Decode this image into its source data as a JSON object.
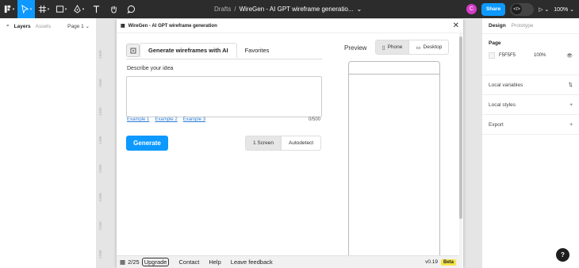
{
  "toolbar": {
    "breadcrumb_root": "Drafts",
    "breadcrumb_sep": "/",
    "file_name": "WireGen - AI GPT wireframe generatio...",
    "avatar_initial": "C",
    "share_label": "Share",
    "zoom": "100%"
  },
  "left_panel": {
    "tab_layers": "Layers",
    "tab_assets": "Assets",
    "page_selector": "Page 1"
  },
  "ruler_ticks": [
    "-1550",
    "-1500",
    "-1450",
    "-1400",
    "-1350",
    "-1300",
    "-1250",
    "-1200"
  ],
  "plugin": {
    "title": "WireGen - AI GPT wireframe generation",
    "tabs": [
      {
        "label": "Generate wireframes with AI"
      },
      {
        "label": "Favorites"
      }
    ],
    "idea_label": "Describe your idea",
    "idea_value": "",
    "examples": [
      "Example 1",
      "Example 2",
      "Example 3"
    ],
    "char_count": "0/500",
    "generate_label": "Generate",
    "mode_options": [
      "1 Screen",
      "Autodetect"
    ],
    "mode_selected": "1 Screen",
    "preview_label": "Preview",
    "device_options": [
      "Phone",
      "Desktop"
    ],
    "device_selected": "Phone",
    "footer": {
      "usage": "2/25",
      "upgrade": "Upgrade",
      "links": [
        "Contact",
        "Help",
        "Leave feedback"
      ],
      "version": "v0.19",
      "badge": "Beta"
    }
  },
  "right_panel": {
    "tab_design": "Design",
    "tab_prototype": "Prototype",
    "page_heading": "Page",
    "page_color": "F5F5F5",
    "page_opacity": "100%",
    "sections": [
      "Local variables",
      "Local styles",
      "Export"
    ]
  },
  "help_label": "?",
  "colors": {
    "accent": "#0d99ff",
    "toolbar_bg": "#2c2c2c",
    "avatar": "#d63cc9",
    "beta_badge": "#f5e548"
  }
}
